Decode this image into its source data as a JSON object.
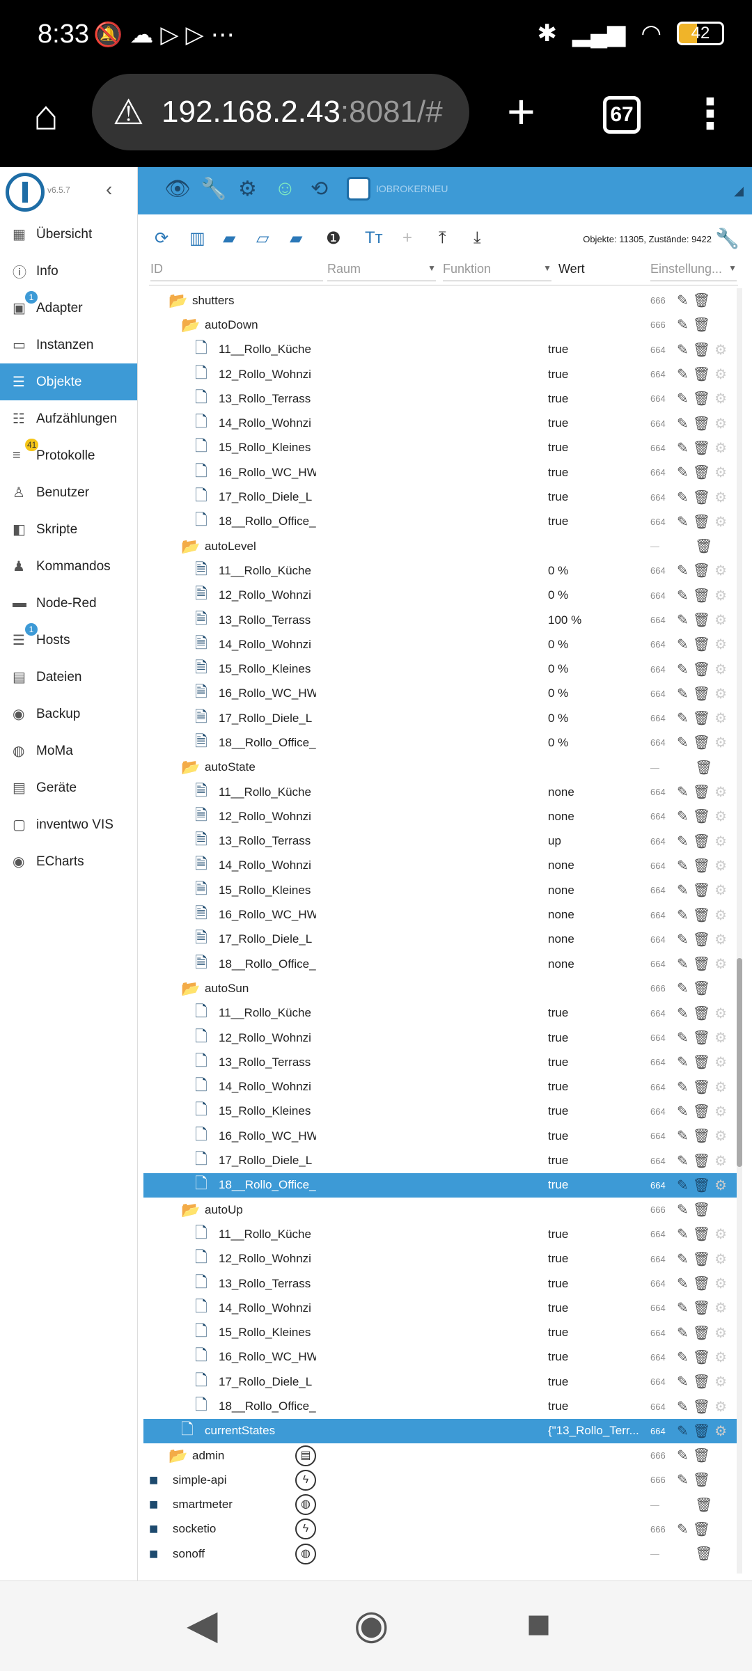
{
  "status_bar": {
    "time": "8:33",
    "battery": "42"
  },
  "browser": {
    "url_host": "192.168.2.43",
    "url_rest": ":8081/#",
    "tab_count": "67"
  },
  "sidebar": {
    "version": "v6.5.7",
    "items": [
      {
        "label": "Übersicht",
        "icon": "▦"
      },
      {
        "label": "Info",
        "icon": "ⓘ"
      },
      {
        "label": "Adapter",
        "icon": "▣",
        "badge": "1"
      },
      {
        "label": "Instanzen",
        "icon": "▭"
      },
      {
        "label": "Objekte",
        "icon": "☰",
        "active": true
      },
      {
        "label": "Aufzählungen",
        "icon": "☷"
      },
      {
        "label": "Protokolle",
        "icon": "≡",
        "badge": "41",
        "badge_color": "yellow"
      },
      {
        "label": "Benutzer",
        "icon": "♙"
      },
      {
        "label": "Skripte",
        "icon": "◧"
      },
      {
        "label": "Kommandos",
        "icon": "♟"
      },
      {
        "label": "Node-Red",
        "icon": "▬"
      },
      {
        "label": "Hosts",
        "icon": "☰",
        "badge": "1"
      },
      {
        "label": "Dateien",
        "icon": "▤"
      },
      {
        "label": "Backup",
        "icon": "◉"
      },
      {
        "label": "MoMa",
        "icon": "◍"
      },
      {
        "label": "Geräte",
        "icon": "▤"
      },
      {
        "label": "inventwo VIS",
        "icon": "▢"
      },
      {
        "label": "ECharts",
        "icon": "◉"
      }
    ]
  },
  "topbar": {
    "brand": "IOBROKERNEU"
  },
  "toolbar": {
    "count": "Objekte: 11305, Zustände: 9422"
  },
  "filters": {
    "id": "ID",
    "raum": "Raum",
    "funktion": "Funktion",
    "wert": "Wert",
    "einstellung": "Einstellung..."
  },
  "tree": [
    {
      "name": "shutters",
      "level": 1,
      "type": "folder-open",
      "acl": "666"
    },
    {
      "name": "autoDown",
      "level": 2,
      "type": "folder-open",
      "acl": "666"
    },
    {
      "name": "11__Rollo_Küche",
      "level": 3,
      "type": "file",
      "value": "true",
      "acl": "664"
    },
    {
      "name": "12_Rollo_Wohnzi",
      "level": 3,
      "type": "file",
      "value": "true",
      "acl": "664"
    },
    {
      "name": "13_Rollo_Terrass",
      "level": 3,
      "type": "file",
      "value": "true",
      "acl": "664"
    },
    {
      "name": "14_Rollo_Wohnzi",
      "level": 3,
      "type": "file",
      "value": "true",
      "acl": "664"
    },
    {
      "name": "15_Rollo_Kleines",
      "level": 3,
      "type": "file",
      "value": "true",
      "acl": "664"
    },
    {
      "name": "16_Rollo_WC_HW",
      "level": 3,
      "type": "file",
      "value": "true",
      "acl": "664"
    },
    {
      "name": "17_Rollo_Diele_L",
      "level": 3,
      "type": "file",
      "value": "true",
      "acl": "664"
    },
    {
      "name": "18__Rollo_Office_",
      "level": 3,
      "type": "file",
      "value": "true",
      "acl": "664"
    },
    {
      "name": "autoLevel",
      "level": 2,
      "type": "folder-open",
      "acl": "—"
    },
    {
      "name": "11__Rollo_Küche",
      "level": 3,
      "type": "file-lock",
      "value": "0 %",
      "acl": "664"
    },
    {
      "name": "12_Rollo_Wohnzi",
      "level": 3,
      "type": "file-lock",
      "value": "0 %",
      "acl": "664"
    },
    {
      "name": "13_Rollo_Terrass",
      "level": 3,
      "type": "file-lock",
      "value": "100 %",
      "acl": "664"
    },
    {
      "name": "14_Rollo_Wohnzi",
      "level": 3,
      "type": "file-lock",
      "value": "0 %",
      "acl": "664"
    },
    {
      "name": "15_Rollo_Kleines",
      "level": 3,
      "type": "file-lock",
      "value": "0 %",
      "acl": "664"
    },
    {
      "name": "16_Rollo_WC_HW",
      "level": 3,
      "type": "file-lock",
      "value": "0 %",
      "acl": "664"
    },
    {
      "name": "17_Rollo_Diele_L",
      "level": 3,
      "type": "file-lock",
      "value": "0 %",
      "acl": "664"
    },
    {
      "name": "18__Rollo_Office_",
      "level": 3,
      "type": "file-lock",
      "value": "0 %",
      "acl": "664"
    },
    {
      "name": "autoState",
      "level": 2,
      "type": "folder-open",
      "acl": "—"
    },
    {
      "name": "11__Rollo_Küche",
      "level": 3,
      "type": "file-lock",
      "value": "none",
      "acl": "664"
    },
    {
      "name": "12_Rollo_Wohnzi",
      "level": 3,
      "type": "file-lock",
      "value": "none",
      "acl": "664"
    },
    {
      "name": "13_Rollo_Terrass",
      "level": 3,
      "type": "file-lock",
      "value": "up",
      "acl": "664"
    },
    {
      "name": "14_Rollo_Wohnzi",
      "level": 3,
      "type": "file-lock",
      "value": "none",
      "acl": "664"
    },
    {
      "name": "15_Rollo_Kleines",
      "level": 3,
      "type": "file-lock",
      "value": "none",
      "acl": "664"
    },
    {
      "name": "16_Rollo_WC_HW",
      "level": 3,
      "type": "file-lock",
      "value": "none",
      "acl": "664"
    },
    {
      "name": "17_Rollo_Diele_L",
      "level": 3,
      "type": "file-lock",
      "value": "none",
      "acl": "664"
    },
    {
      "name": "18__Rollo_Office_",
      "level": 3,
      "type": "file-lock",
      "value": "none",
      "acl": "664"
    },
    {
      "name": "autoSun",
      "level": 2,
      "type": "folder-open",
      "acl": "666"
    },
    {
      "name": "11__Rollo_Küche",
      "level": 3,
      "type": "file",
      "value": "true",
      "acl": "664"
    },
    {
      "name": "12_Rollo_Wohnzi",
      "level": 3,
      "type": "file",
      "value": "true",
      "acl": "664"
    },
    {
      "name": "13_Rollo_Terrass",
      "level": 3,
      "type": "file",
      "value": "true",
      "acl": "664"
    },
    {
      "name": "14_Rollo_Wohnzi",
      "level": 3,
      "type": "file",
      "value": "true",
      "acl": "664"
    },
    {
      "name": "15_Rollo_Kleines",
      "level": 3,
      "type": "file",
      "value": "true",
      "acl": "664"
    },
    {
      "name": "16_Rollo_WC_HW",
      "level": 3,
      "type": "file",
      "value": "true",
      "acl": "664"
    },
    {
      "name": "17_Rollo_Diele_L",
      "level": 3,
      "type": "file",
      "value": "true",
      "acl": "664"
    },
    {
      "name": "18__Rollo_Office_",
      "level": 3,
      "type": "file",
      "value": "true",
      "acl": "664",
      "selected": true
    },
    {
      "name": "autoUp",
      "level": 2,
      "type": "folder-open",
      "acl": "666"
    },
    {
      "name": "11__Rollo_Küche",
      "level": 3,
      "type": "file",
      "value": "true",
      "acl": "664"
    },
    {
      "name": "12_Rollo_Wohnzi",
      "level": 3,
      "type": "file",
      "value": "true",
      "acl": "664"
    },
    {
      "name": "13_Rollo_Terrass",
      "level": 3,
      "type": "file",
      "value": "true",
      "acl": "664"
    },
    {
      "name": "14_Rollo_Wohnzi",
      "level": 3,
      "type": "file",
      "value": "true",
      "acl": "664"
    },
    {
      "name": "15_Rollo_Kleines",
      "level": 3,
      "type": "file",
      "value": "true",
      "acl": "664"
    },
    {
      "name": "16_Rollo_WC_HW",
      "level": 3,
      "type": "file",
      "value": "true",
      "acl": "664"
    },
    {
      "name": "17_Rollo_Diele_L",
      "level": 3,
      "type": "file",
      "value": "true",
      "acl": "664"
    },
    {
      "name": "18__Rollo_Office_",
      "level": 3,
      "type": "file",
      "value": "true",
      "acl": "664"
    },
    {
      "name": "currentStates",
      "level": 2,
      "type": "file",
      "value": "{\"13_Rollo_Terr...",
      "acl": "664",
      "selected": true
    },
    {
      "name": "admin",
      "level": 1,
      "type": "folder-open",
      "acl": "666",
      "adapter_icon": "doc"
    },
    {
      "name": "simple-api",
      "level": 0,
      "type": "folder",
      "acl": "666",
      "adapter_icon": "bolt"
    },
    {
      "name": "smartmeter",
      "level": 0,
      "type": "folder",
      "acl": "—",
      "adapter_icon": "meter"
    },
    {
      "name": "socketio",
      "level": 0,
      "type": "folder",
      "acl": "666",
      "adapter_icon": "bolt"
    },
    {
      "name": "sonoff",
      "level": 0,
      "type": "folder",
      "acl": "—",
      "adapter_icon": "sonoff"
    }
  ]
}
